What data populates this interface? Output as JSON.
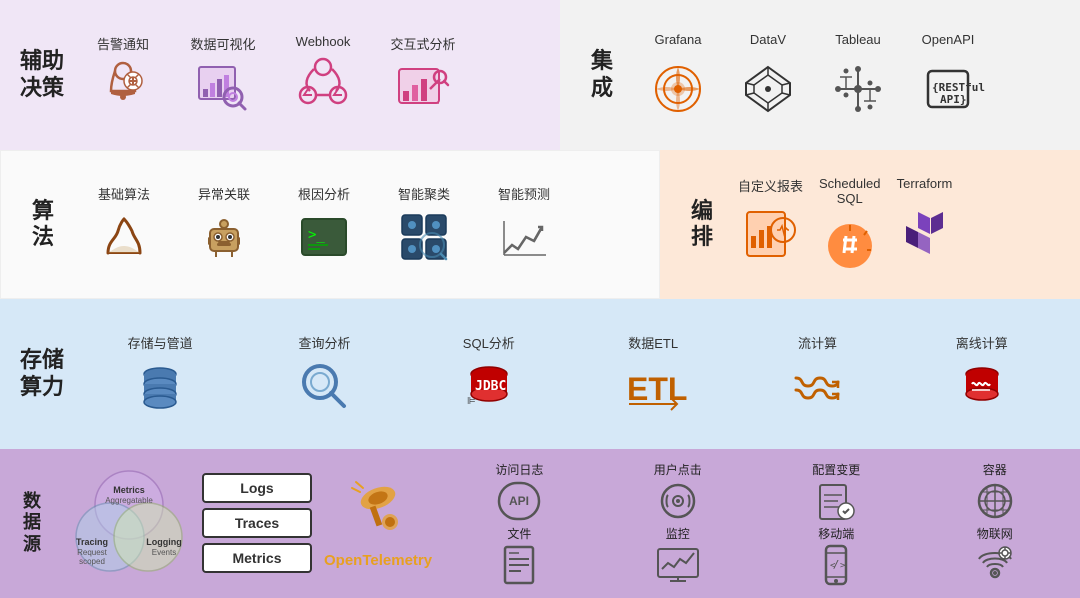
{
  "rows": {
    "row1": {
      "left": {
        "title": "辅助\n决策",
        "items": [
          {
            "label": "告警通知",
            "icon": "bell-gear"
          },
          {
            "label": "数据可视化",
            "icon": "chart-search"
          },
          {
            "label": "Webhook",
            "icon": "webhook"
          },
          {
            "label": "交互式分析",
            "icon": "interactive-chart"
          }
        ]
      },
      "right": {
        "title": "集\n成",
        "items": [
          {
            "label": "Grafana",
            "icon": "grafana"
          },
          {
            "label": "DataV",
            "icon": "datav"
          },
          {
            "label": "Tableau",
            "icon": "tableau"
          },
          {
            "label": "OpenAPI",
            "icon": "openapi"
          }
        ]
      }
    },
    "row2": {
      "left": {
        "title": "算\n法",
        "items": [
          {
            "label": "基础算法",
            "icon": "base-algo"
          },
          {
            "label": "异常关联",
            "icon": "robot"
          },
          {
            "label": "根因分析",
            "icon": "terminal"
          },
          {
            "label": "智能聚类",
            "icon": "cluster"
          },
          {
            "label": "智能预测",
            "icon": "prediction"
          }
        ]
      },
      "right": {
        "title": "编\n排",
        "items": [
          {
            "label": "自定义报表",
            "icon": "custom-report"
          },
          {
            "label": "Scheduled\nSQL",
            "icon": "scheduled-sql"
          },
          {
            "label": "Terraform",
            "icon": "terraform"
          }
        ]
      }
    },
    "row3": {
      "title": "存储\n算力",
      "items": [
        {
          "label": "存储与管道",
          "icon": "storage"
        },
        {
          "label": "查询分析",
          "icon": "search-analysis"
        },
        {
          "label": "SQL分析",
          "icon": "jdbc"
        },
        {
          "label": "数据ETL",
          "icon": "etl"
        },
        {
          "label": "流计算",
          "icon": "stream-compute"
        },
        {
          "label": "离线计算",
          "icon": "offline-compute"
        }
      ]
    },
    "row4": {
      "title": "数\n据\n源",
      "venn": {
        "circles": [
          "Metrics\nAggregatable",
          "Tracing\nRequest\nscoped",
          "Logging\nEvents"
        ]
      },
      "ltm": [
        "Logs",
        "Traces",
        "Metrics"
      ],
      "opentelemetry": "OpenTelemetry",
      "datasources": [
        {
          "label": "访问日志",
          "icon": "api-icon"
        },
        {
          "label": "用户点击",
          "icon": "click-icon"
        },
        {
          "label": "配置变更",
          "icon": "config-icon"
        },
        {
          "label": "容器",
          "icon": "container-icon"
        },
        {
          "label": "文件",
          "icon": "file-icon"
        },
        {
          "label": "监控",
          "icon": "monitor-icon"
        },
        {
          "label": "移动端",
          "icon": "mobile-icon"
        },
        {
          "label": "物联网",
          "icon": "iot-icon"
        }
      ]
    }
  }
}
